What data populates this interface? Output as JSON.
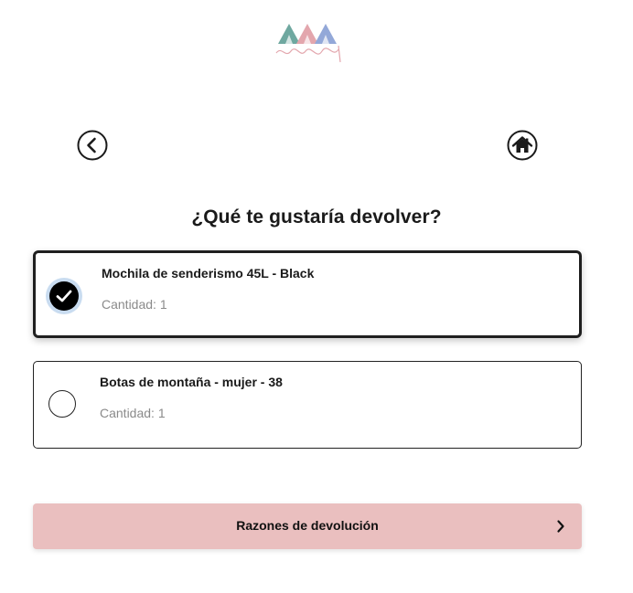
{
  "brand": {
    "logo_icon": "tents-logo-icon",
    "colors": [
      "#6fa8a0",
      "#e3a6ad",
      "#93a8d8"
    ]
  },
  "nav": {
    "back_icon": "chevron-left-circle-icon",
    "home_icon": "home-circle-icon"
  },
  "heading": "¿Qué te gustaría devolver?",
  "items": [
    {
      "name": "Mochila de senderismo 45L - Black",
      "quantity": "Cantidad: 1",
      "selected": true
    },
    {
      "name": "Botas de montaña - mujer - 38",
      "quantity": "Cantidad: 1",
      "selected": false
    }
  ],
  "cta": {
    "label": "Razones de devolución",
    "icon": "chevron-right-icon",
    "color": "#eabfbf"
  },
  "accent": {
    "selected_ring": "#c9dcf0",
    "border": "#1f1f1f"
  }
}
